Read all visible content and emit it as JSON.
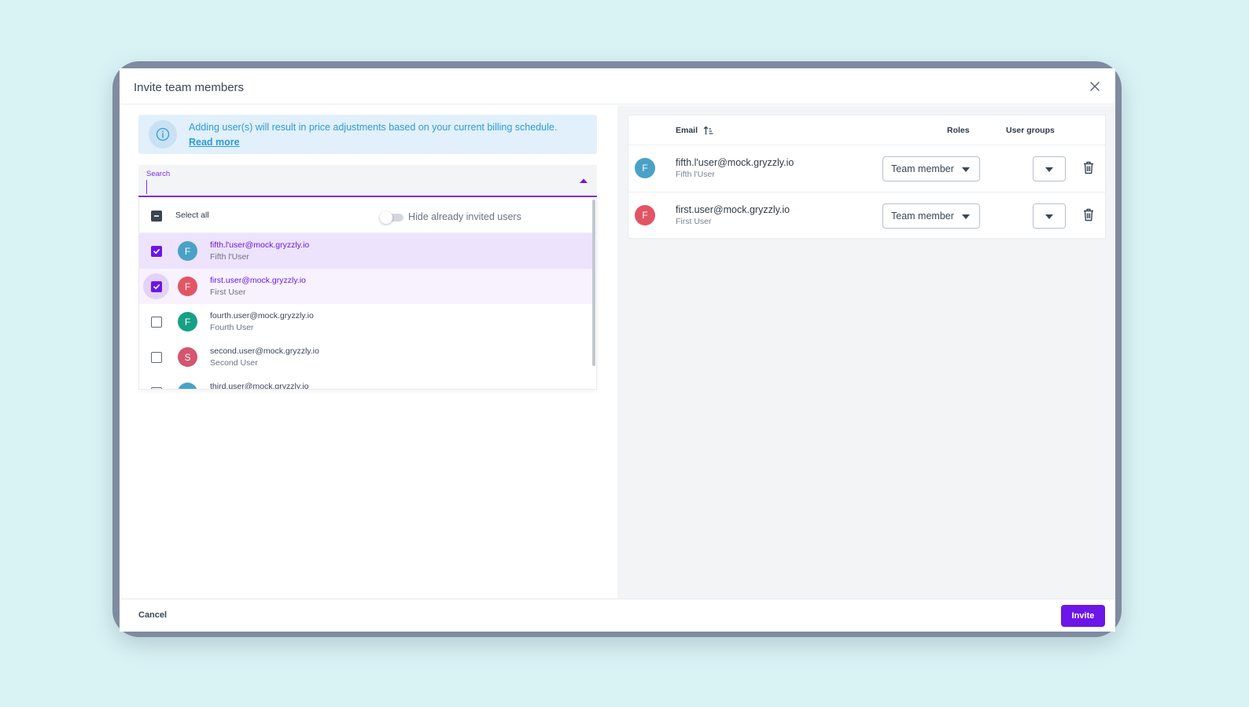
{
  "dialog": {
    "title": "Invite team members",
    "close_icon": "close-icon"
  },
  "banner": {
    "icon": "info-icon",
    "text": "Adding user(s) will result in price adjustments based on your current billing schedule.",
    "link": "Read more"
  },
  "search": {
    "label": "Search",
    "value": "",
    "toggle_icon": "chevron-up-icon"
  },
  "list": {
    "select_all_label": "Select all",
    "select_all_state": "indeterminate",
    "hide_invited_label": "Hide already invited users",
    "hide_invited_on": false,
    "users": [
      {
        "initial": "F",
        "email": "fifth.l'user@mock.gryzzly.io",
        "name": "Fifth l'User",
        "checked": true,
        "color": "#4aa1c7"
      },
      {
        "initial": "F",
        "email": "first.user@mock.gryzzly.io",
        "name": "First User",
        "checked": true,
        "color": "#e25564"
      },
      {
        "initial": "F",
        "email": "fourth.user@mock.gryzzly.io",
        "name": "Fourth User",
        "checked": false,
        "color": "#16a085"
      },
      {
        "initial": "S",
        "email": "second.user@mock.gryzzly.io",
        "name": "Second User",
        "checked": false,
        "color": "#d4566f"
      },
      {
        "initial": "T",
        "email": "third.user@mock.gryzzly.io",
        "name": "",
        "checked": false,
        "color": "#4aa1c7"
      }
    ]
  },
  "table": {
    "headers": {
      "email": "Email",
      "roles": "Roles",
      "user_groups": "User groups"
    },
    "sort_icon": "sort-ascending-icon",
    "rows": [
      {
        "initial": "F",
        "email": "fifth.l'user@mock.gryzzly.io",
        "name": "Fifth l'User",
        "role": "Team member",
        "color": "#4aa1c7"
      },
      {
        "initial": "F",
        "email": "first.user@mock.gryzzly.io",
        "name": "First User",
        "role": "Team member",
        "color": "#e25564"
      }
    ]
  },
  "footer": {
    "cancel_label": "Cancel",
    "invite_label": "Invite"
  },
  "colors": {
    "accent": "#6c16e8",
    "info": "#2d9bd4",
    "background": "#d9f3f5"
  }
}
